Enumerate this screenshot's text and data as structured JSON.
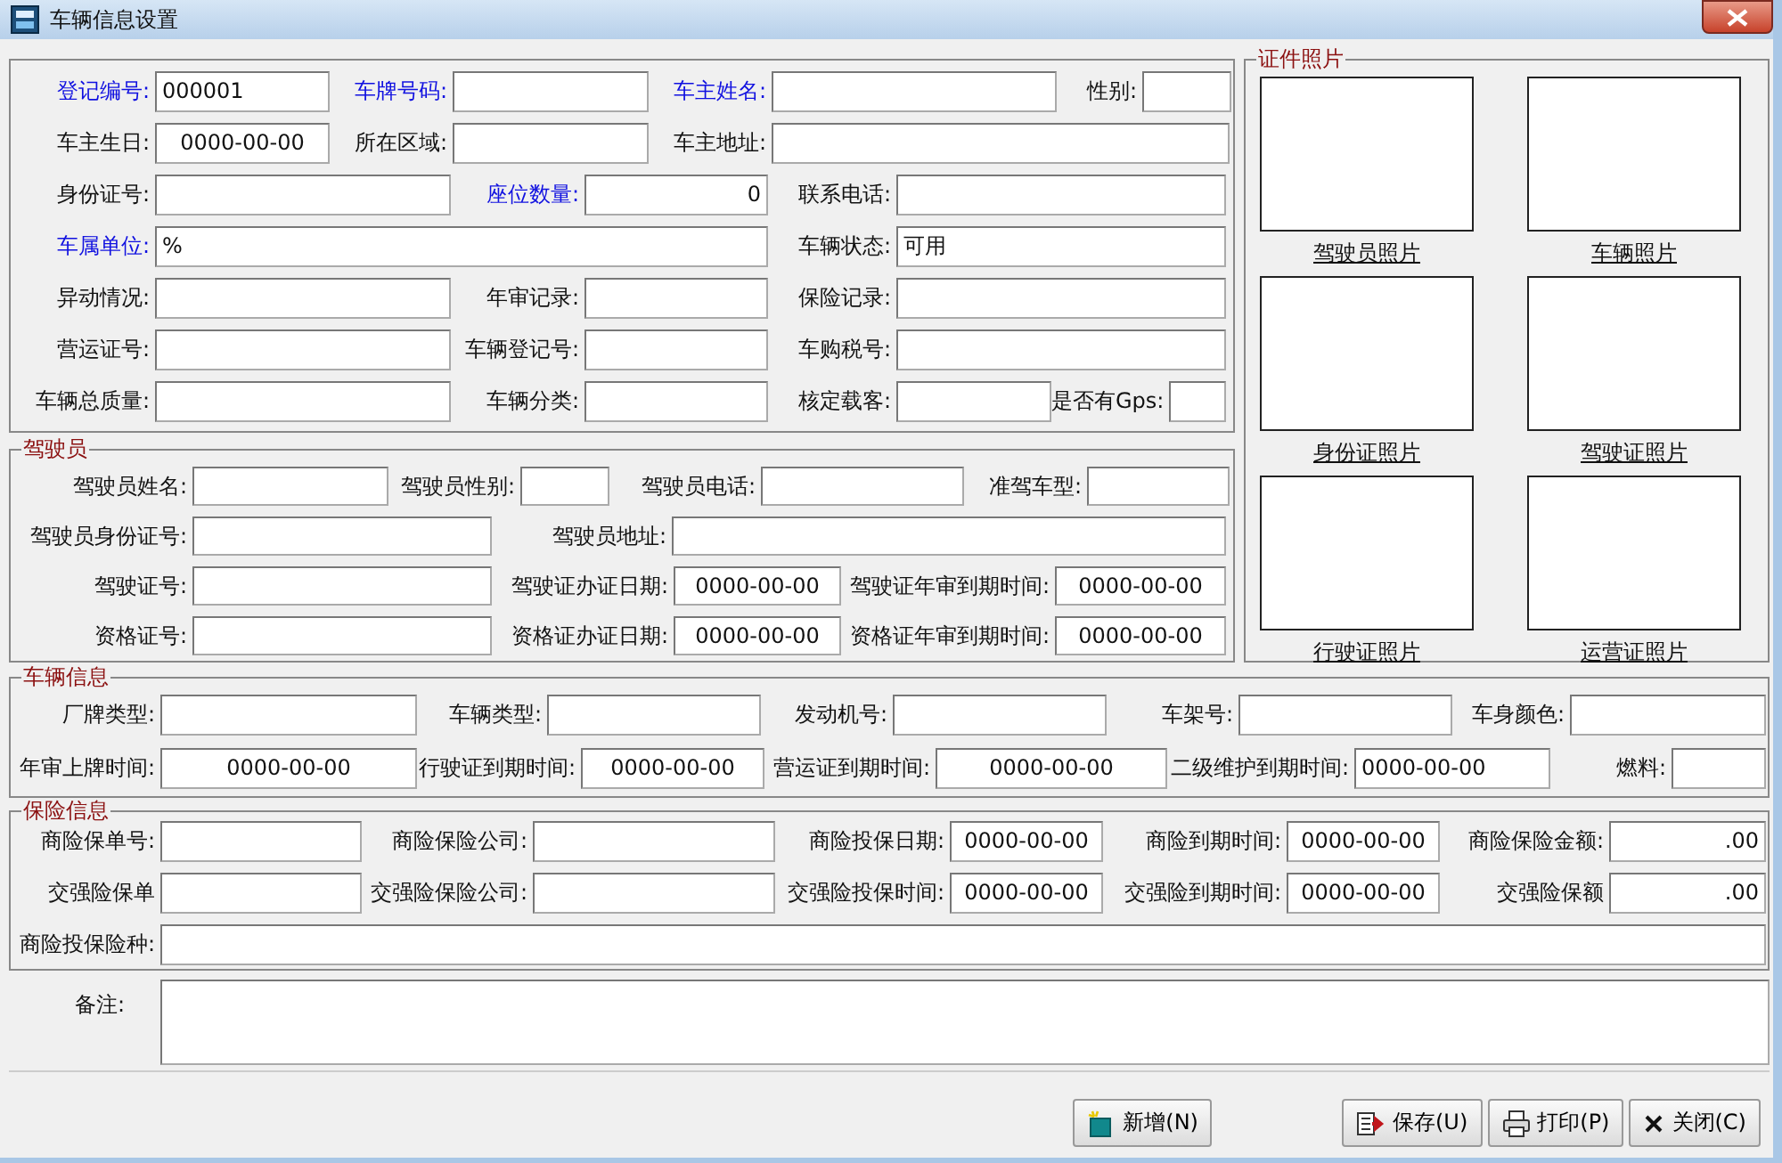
{
  "window": {
    "title": "车辆信息设置"
  },
  "vehicle_form": {
    "lines": [
      [
        {
          "label": "登记编号:",
          "required": true,
          "value": "000001",
          "kind": "text"
        },
        {
          "label": "车牌号码:",
          "required": true,
          "kind": "text"
        },
        {
          "label": "车主姓名:",
          "required": true,
          "kind": "text"
        },
        {
          "label": "性别:",
          "required": false,
          "kind": "text"
        }
      ],
      [
        {
          "label": "车主生日:",
          "required": false,
          "value": "0000-00-00",
          "kind": "date"
        },
        {
          "label": "所在区域:",
          "required": false,
          "kind": "text"
        },
        {
          "label": "车主地址:",
          "required": false,
          "kind": "text"
        }
      ],
      [
        {
          "label": "身份证号:",
          "required": false,
          "kind": "text"
        },
        {
          "label": "座位数量:",
          "required": true,
          "value": "0",
          "kind": "number"
        },
        {
          "label": "联系电话:",
          "required": false,
          "kind": "text"
        }
      ],
      [
        {
          "label": "车属单位:",
          "required": true,
          "value": "%",
          "kind": "text"
        },
        {
          "label": "车辆状态:",
          "required": false,
          "value": "可用",
          "kind": "text"
        }
      ],
      [
        {
          "label": "异动情况:",
          "required": false,
          "kind": "text"
        },
        {
          "label": "年审记录:",
          "required": false,
          "kind": "text"
        },
        {
          "label": "保险记录:",
          "required": false,
          "kind": "text"
        }
      ],
      [
        {
          "label": "营运证号:",
          "required": false,
          "kind": "text"
        },
        {
          "label": "车辆登记号:",
          "required": false,
          "kind": "text"
        },
        {
          "label": "车购税号:",
          "required": false,
          "kind": "text"
        }
      ],
      [
        {
          "label": "车辆总质量:",
          "required": false,
          "kind": "text"
        },
        {
          "label": "车辆分类:",
          "required": false,
          "kind": "text"
        },
        {
          "label": "核定载客:",
          "required": false,
          "kind": "text"
        },
        {
          "label": "是否有Gps:",
          "required": false,
          "kind": "text"
        }
      ]
    ]
  },
  "photos": {
    "title": "证件照片",
    "items": [
      {
        "caption": "驾驶员照片"
      },
      {
        "caption": "车辆照片"
      },
      {
        "caption": "身份证照片"
      },
      {
        "caption": "驾驶证照片"
      },
      {
        "caption": "行驶证照片"
      },
      {
        "caption": "运营证照片"
      }
    ]
  },
  "driver": {
    "title": "驾驶员",
    "lines": [
      [
        {
          "label": "驾驶员姓名:",
          "kind": "text"
        },
        {
          "label": "驾驶员性别:",
          "kind": "text"
        },
        {
          "label": "驾驶员电话:",
          "kind": "text"
        },
        {
          "label": "准驾车型:",
          "kind": "text"
        }
      ],
      [
        {
          "label": "驾驶员身份证号:",
          "kind": "text"
        },
        {
          "label": "驾驶员地址:",
          "kind": "text"
        }
      ],
      [
        {
          "label": "驾驶证号:",
          "kind": "text"
        },
        {
          "label": "驾驶证办证日期:",
          "value": "0000-00-00",
          "kind": "date"
        },
        {
          "label": "驾驶证年审到期时间:",
          "value": "0000-00-00",
          "kind": "date"
        }
      ],
      [
        {
          "label": "资格证号:",
          "kind": "text"
        },
        {
          "label": "资格证办证日期:",
          "value": "0000-00-00",
          "kind": "date"
        },
        {
          "label": "资格证年审到期时间:",
          "value": "0000-00-00",
          "kind": "date"
        }
      ]
    ]
  },
  "vehicle_info": {
    "title": "车辆信息",
    "lines": [
      [
        {
          "label": "厂牌类型:",
          "kind": "text"
        },
        {
          "label": "车辆类型:",
          "kind": "text"
        },
        {
          "label": "发动机号:",
          "kind": "text"
        },
        {
          "label": "车架号:",
          "kind": "text"
        },
        {
          "label": "车身颜色:",
          "kind": "text"
        }
      ],
      [
        {
          "label": "年审上牌时间:",
          "value": "0000-00-00",
          "kind": "date"
        },
        {
          "label": "行驶证到期时间:",
          "value": "0000-00-00",
          "kind": "date"
        },
        {
          "label": "营运证到期时间:",
          "value": "0000-00-00",
          "kind": "date"
        },
        {
          "label": "二级维护到期时间:",
          "value": "0000-00-00",
          "kind": "text"
        },
        {
          "label": "燃料:",
          "kind": "text"
        }
      ]
    ]
  },
  "insurance": {
    "title": "保险信息",
    "lines": [
      [
        {
          "label": "商险保单号:",
          "kind": "text"
        },
        {
          "label": "商险保险公司:",
          "kind": "text"
        },
        {
          "label": "商险投保日期:",
          "value": "0000-00-00",
          "kind": "date"
        },
        {
          "label": "商险到期时间:",
          "value": "0000-00-00",
          "kind": "date"
        },
        {
          "label": "商险保险金额:",
          "value": ".00",
          "kind": "number"
        }
      ],
      [
        {
          "label": "交强险保单",
          "kind": "text"
        },
        {
          "label": "交强险保险公司:",
          "kind": "text"
        },
        {
          "label": "交强险投保时间:",
          "value": "0000-00-00",
          "kind": "date"
        },
        {
          "label": "交强险到期时间:",
          "value": "0000-00-00",
          "kind": "date"
        },
        {
          "label": "交强险保额",
          "value": ".00",
          "kind": "number"
        }
      ],
      [
        {
          "label": "商险投保险种:",
          "kind": "text"
        }
      ]
    ]
  },
  "remarks": {
    "label": "备注:"
  },
  "buttons": [
    {
      "label": "新增(N)",
      "kind": "new"
    },
    {
      "label": "保存(U)",
      "kind": "save"
    },
    {
      "label": "打印(P)",
      "kind": "print"
    },
    {
      "label": "关闭(C)",
      "kind": "close"
    }
  ]
}
